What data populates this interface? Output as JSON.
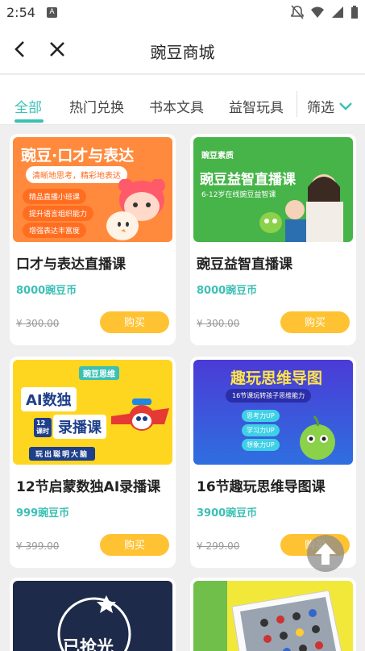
{
  "status_bar": {
    "time": "2:54"
  },
  "header": {
    "title": "豌豆商城"
  },
  "tabs": [
    {
      "label": "全部",
      "active": true
    },
    {
      "label": "热门兑换",
      "active": false
    },
    {
      "label": "书本文具",
      "active": false
    },
    {
      "label": "益智玩具",
      "active": false
    }
  ],
  "filter_label": "筛选",
  "accent_color": "#3cc0b4",
  "buy_color": "#ffc233",
  "products": [
    {
      "name": "口才与表达直播课",
      "price": "8000豌豆币",
      "original_price": "¥ 300.00",
      "buy_label": "购买",
      "banner": {
        "title": "豌豆·口才与表达",
        "subtitle": "清晰地思考，精彩地表达",
        "points": [
          "精品直播小班课",
          "提升语言组织能力",
          "增强表达丰富度"
        ]
      }
    },
    {
      "name": "豌豆益智直播课",
      "price": "8000豌豆币",
      "original_price": "¥ 300.00",
      "buy_label": "购买",
      "banner": {
        "brand": "豌豆素质",
        "title": "豌豆益智直播课",
        "subtitle": "6-12岁在线豌豆益智课"
      }
    },
    {
      "name": "12节启蒙数独AI录播课",
      "price": "999豌豆币",
      "original_price": "¥ 399.00",
      "buy_label": "购买",
      "banner": {
        "brand": "豌豆思维",
        "title_line1": "AI数独",
        "title_line2": "录播课",
        "badge": "12课时",
        "footer": "玩出聪明大脑"
      }
    },
    {
      "name": "16节趣玩思维导图课",
      "price": "3900豌豆币",
      "original_price": "¥ 299.00",
      "buy_label": "购买",
      "banner": {
        "title": "趣玩思维导图",
        "subtitle": "16节课玩转孩子思维能力",
        "tags": [
          "思考力UP",
          "学习力UP",
          "想象力UP"
        ]
      }
    }
  ],
  "partial_cards": [
    {
      "stamp": "已抢光"
    }
  ]
}
